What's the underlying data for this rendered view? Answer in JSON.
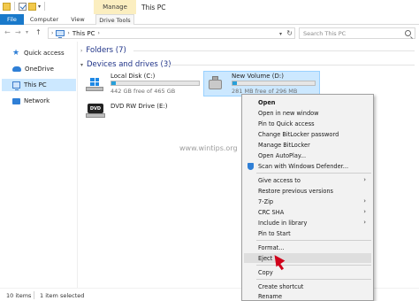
{
  "window": {
    "title": "This PC",
    "contextual_tab": "Manage"
  },
  "ribbon": {
    "tabs": [
      "File",
      "Computer",
      "View",
      "Drive Tools"
    ]
  },
  "address": {
    "path": "This PC",
    "chevron": "›",
    "search_placeholder": "Search This PC"
  },
  "sidebar": {
    "items": [
      {
        "label": "Quick access"
      },
      {
        "label": "OneDrive"
      },
      {
        "label": "This PC"
      },
      {
        "label": "Network"
      }
    ]
  },
  "content": {
    "folders_header": "Folders (7)",
    "devices_header": "Devices and drives (3)",
    "drives": [
      {
        "name": "Local Disk (C:)",
        "size": "442 GB free of 465 GB",
        "used_fraction": 0.05
      },
      {
        "name": "New Volume (D:)",
        "size": "281 MB free of 296 MB",
        "used_fraction": 0.05
      },
      {
        "name": "DVD RW Drive (E:)",
        "icon_text": "DVD"
      }
    ],
    "watermark": "www.wintips.org"
  },
  "status": {
    "items_count": "10 items",
    "selected": "1 item selected"
  },
  "context_menu": {
    "items": [
      {
        "label": "Open"
      },
      {
        "label": "Open in new window"
      },
      {
        "label": "Pin to Quick access"
      },
      {
        "label": "Change BitLocker password"
      },
      {
        "label": "Manage BitLocker"
      },
      {
        "label": "Open AutoPlay..."
      },
      {
        "label": "Scan with Windows Defender..."
      },
      {
        "label": "Give access to"
      },
      {
        "label": "Restore previous versions"
      },
      {
        "label": "7-Zip"
      },
      {
        "label": "CRC SHA"
      },
      {
        "label": "Include in library"
      },
      {
        "label": "Pin to Start"
      },
      {
        "label": "Format..."
      },
      {
        "label": "Eject"
      },
      {
        "label": "Copy"
      },
      {
        "label": "Create shortcut"
      },
      {
        "label": "Rename"
      }
    ],
    "submenu_arrow": "›"
  },
  "colors": {
    "accent": "#1979ca",
    "selection": "#cce8ff",
    "manage_tab": "#fbeec0",
    "drive_bar": "#26a0da",
    "cursor": "#d0021b"
  }
}
